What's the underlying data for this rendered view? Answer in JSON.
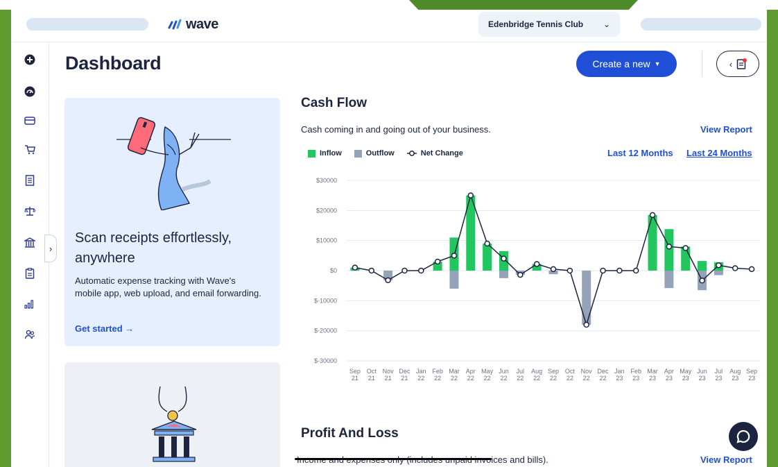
{
  "header": {
    "logo_text": "wave",
    "business_name": "Edenbridge Tennis Club"
  },
  "sidebar": {
    "icons": [
      "plus-circle-icon",
      "dashboard-icon",
      "credit-card-icon",
      "cart-icon",
      "receipt-icon",
      "scale-icon",
      "bank-icon",
      "clipboard-icon",
      "bar-chart-icon",
      "people-icon"
    ]
  },
  "page": {
    "title": "Dashboard",
    "create_button": "Create a new"
  },
  "promo": {
    "heading": "Scan receipts effortlessly, anywhere",
    "body": "Automatic expense tracking with Wave's mobile app, web upload, and email forwarding.",
    "link": "Get started"
  },
  "cash_flow": {
    "title": "Cash Flow",
    "subtitle": "Cash coming in and going out of your business.",
    "view_report": "View Report",
    "legend": {
      "inflow": "Inflow",
      "outflow": "Outflow",
      "net": "Net Change"
    },
    "period_12": "Last 12 Months",
    "period_24": "Last 24 Months"
  },
  "profit_loss": {
    "title": "Profit And Loss",
    "subtitle": "Income and expenses only (includes unpaid invoices and bills).",
    "view_report": "View Report"
  },
  "colors": {
    "inflow": "#22c55e",
    "outflow": "#94a3b8",
    "accent": "#1f4fd6",
    "text": "#1c2440"
  },
  "chart_data": {
    "type": "bar",
    "categories": [
      "Sep 21",
      "Oct 21",
      "Nov 21",
      "Dec 21",
      "Jan 22",
      "Feb 22",
      "Mar 22",
      "Apr 22",
      "May 22",
      "Jun 22",
      "Jul 22",
      "Aug 22",
      "Sep 22",
      "Oct 22",
      "Nov 22",
      "Dec 22",
      "Jan 23",
      "Feb 23",
      "Mar 23",
      "Apr 23",
      "May 23",
      "Jun 23",
      "Jul 23",
      "Aug 23",
      "Sep 23"
    ],
    "series": [
      {
        "name": "Inflow",
        "values": [
          1000,
          0,
          0,
          0,
          0,
          3000,
          11000,
          25000,
          9000,
          6500,
          0,
          2200,
          0,
          0,
          0,
          0,
          0,
          0,
          18500,
          13800,
          8000,
          3200,
          2800,
          0,
          0
        ]
      },
      {
        "name": "Outflow",
        "values": [
          0,
          0,
          -3200,
          0,
          0,
          0,
          -6000,
          0,
          0,
          -2500,
          -1400,
          0,
          -1200,
          0,
          -18000,
          0,
          0,
          0,
          0,
          -5800,
          0,
          -6500,
          -1500,
          0,
          0
        ]
      },
      {
        "name": "Net Change",
        "values": [
          1000,
          0,
          -3200,
          0,
          0,
          3000,
          5000,
          25000,
          9000,
          4000,
          -1400,
          2200,
          500,
          0,
          -18000,
          0,
          0,
          0,
          18500,
          8000,
          7500,
          -3300,
          1800,
          800,
          500
        ]
      }
    ],
    "y_ticks": [
      "$30000",
      "$20000",
      "$10000",
      "$0",
      "$-10000",
      "$-20000",
      "$-30000"
    ],
    "ylim": [
      -30000,
      30000
    ],
    "grid": true,
    "legend_position": "top-left"
  }
}
